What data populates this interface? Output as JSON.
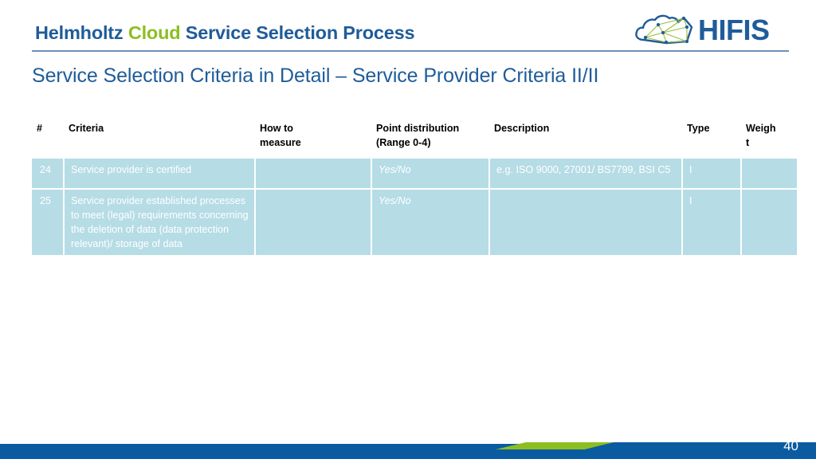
{
  "header": {
    "title_part1": "Helmholtz",
    "title_part2": "Cloud",
    "title_part3": "Service Selection Process",
    "logo_text": "HIFIS",
    "logo_icon": "hifis-cloud-network-logo",
    "colors": {
      "blue": "#1f5c99",
      "green": "#8cbe22",
      "rule": "#6e8fb5"
    }
  },
  "subtitle": "Service Selection Criteria in Detail – Service Provider Criteria II/II",
  "table": {
    "columns": [
      "#",
      "Criteria",
      "How to measure",
      "Point distribution (Range 0-4)",
      "Description",
      "Type",
      "Weigh t"
    ],
    "column_lines": {
      "num": "#",
      "criteria": "Criteria",
      "measure_l1": "How to",
      "measure_l2": "measure",
      "point_l1": "Point distribution",
      "point_l2": "(Range 0-4)",
      "description": "Description",
      "type": "Type",
      "weight_l1": "Weigh",
      "weight_l2": "t"
    },
    "rows": [
      {
        "num": "24",
        "criteria": "Service provider is certified",
        "measure": "",
        "point_distribution": "Yes/No",
        "description": "e.g. ISO 9000, 27001/ BS7799, BSI C5",
        "type": "I",
        "weight": ""
      },
      {
        "num": "25",
        "criteria": "Service provider established processes to meet (legal) requirements concerning the deletion of data (data protection relevant)/ storage of data",
        "measure": "",
        "point_distribution": "Yes/No",
        "description": "",
        "type": "I",
        "weight": ""
      }
    ],
    "cell_background": "#b6dce6",
    "cell_text_color": "#ffffff"
  },
  "footer": {
    "page_number": "40",
    "bar_color": "#0b5ba1",
    "accent_color": "#8cbe22"
  }
}
